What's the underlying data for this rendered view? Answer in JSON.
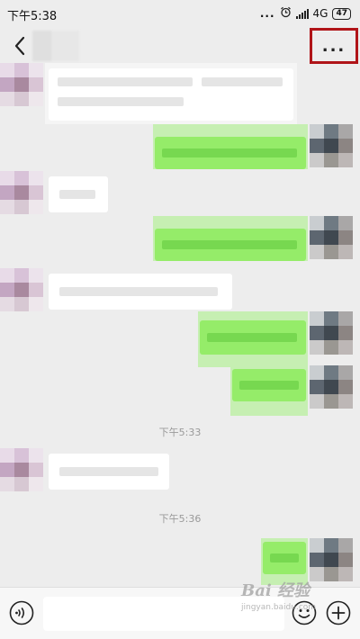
{
  "status_bar": {
    "time": "下午5:38",
    "dots": "...",
    "network": "4G",
    "battery": "47"
  },
  "nav": {
    "more_label": "..."
  },
  "messages": {
    "timestamp_1": "下午5:33",
    "timestamp_2": "下午5:36"
  },
  "input": {
    "value": "",
    "placeholder": ""
  },
  "watermark": {
    "logo": "Bai 经验",
    "url": "jingyan.baidu.com"
  },
  "icons": {
    "back": "chevron-left-icon",
    "more": "more-dots-icon",
    "voice": "voice-icon",
    "emoji": "emoji-icon",
    "plus": "plus-icon",
    "alarm": "alarm-icon",
    "signal": "signal-icon"
  },
  "colors": {
    "background": "#ededed",
    "outgoing_bubble": "#95ec69",
    "incoming_bubble": "#ffffff",
    "highlight_box": "#b01418",
    "timestamp_text": "#9a9a9a"
  }
}
